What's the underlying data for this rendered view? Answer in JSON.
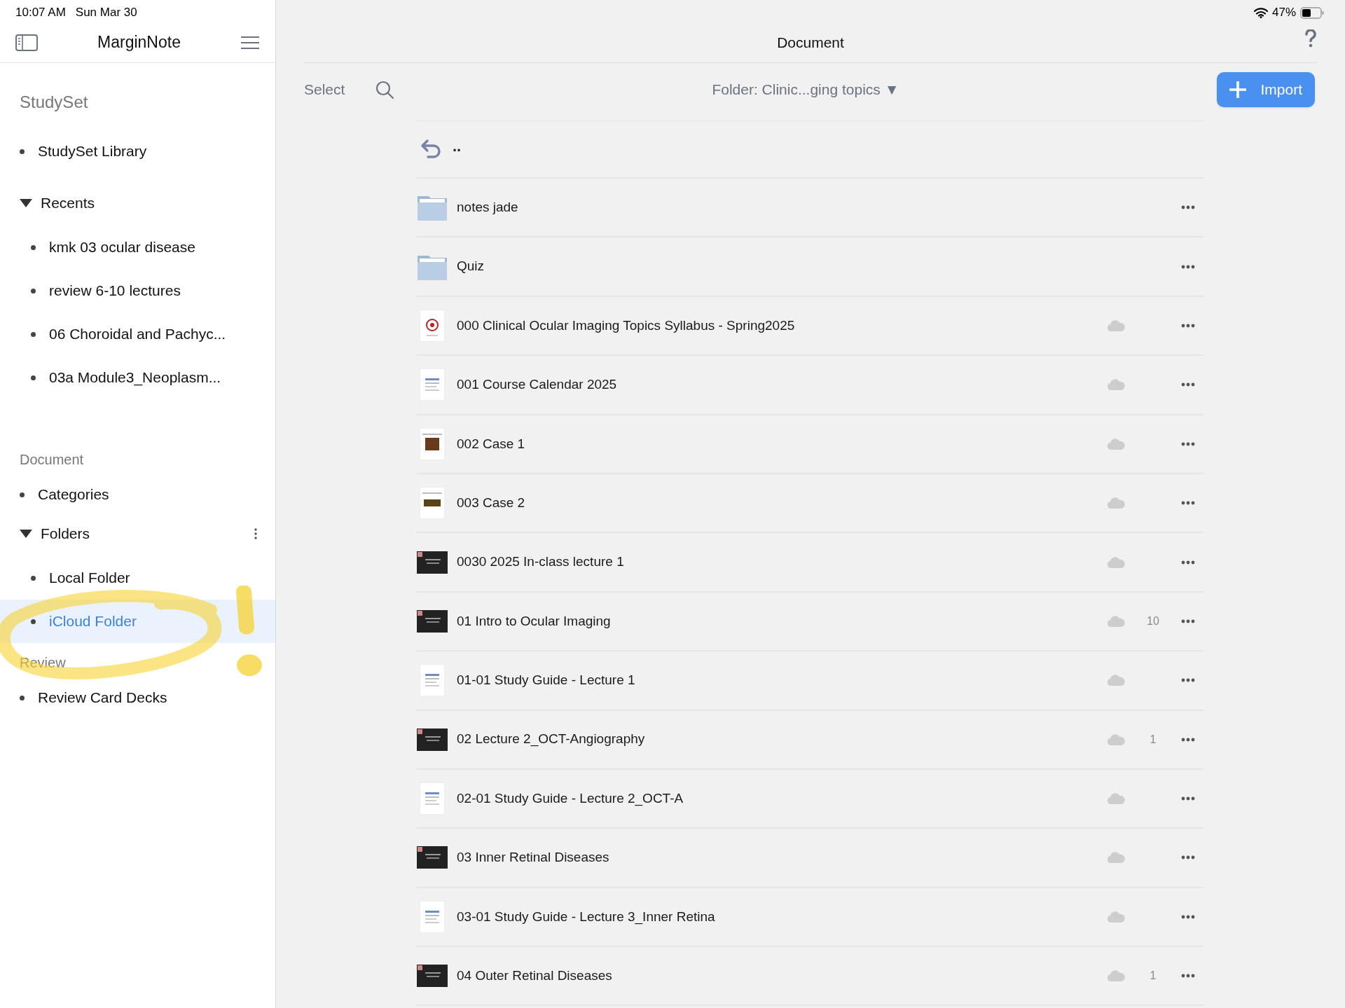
{
  "status_bar": {
    "time": "10:07 AM",
    "date": "Sun Mar 30",
    "battery": "47%"
  },
  "sidebar": {
    "title": "MarginNote",
    "sections": [
      {
        "title": "StudySet",
        "items": [
          {
            "label": "StudySet Library",
            "selected": false
          }
        ]
      },
      {
        "items": [
          {
            "label": "Recents",
            "selected": false,
            "expanded": true,
            "has_menu": false,
            "children": [
              {
                "label": "kmk 03 ocular disease",
                "selected": false
              },
              {
                "label": "review 6-10 lectures",
                "selected": false
              },
              {
                "label": "06 Choroidal and Pachyc...",
                "selected": false
              },
              {
                "label": "03a Module3_Neoplasm...",
                "selected": false
              }
            ]
          }
        ]
      },
      {
        "title": "Document",
        "items": [
          {
            "label": "Categories",
            "selected": false
          },
          {
            "label": "Folders",
            "selected": false,
            "expanded": true,
            "has_menu": true,
            "children": [
              {
                "label": "Local Folder",
                "selected": false
              },
              {
                "label": "iCloud Folder",
                "selected": true
              }
            ]
          }
        ]
      },
      {
        "title": "Review",
        "items": [
          {
            "label": "Review Card Decks",
            "selected": false
          }
        ]
      }
    ]
  },
  "main": {
    "title": "Document",
    "select": "Select",
    "folder": "Folder: Clinic...ging topics ▼",
    "import": "Import",
    "parent": "..",
    "files": [
      {
        "name": "notes jade",
        "kind": "folder"
      },
      {
        "name": "Quiz",
        "kind": "folder"
      },
      {
        "name": "000 Clinical Ocular Imaging Topics Syllabus - Spring2025",
        "kind": "seal"
      },
      {
        "name": "001 Course Calendar 2025",
        "kind": "page"
      },
      {
        "name": "002 Case 1",
        "kind": "photo"
      },
      {
        "name": "003 Case 2",
        "kind": "photo2"
      },
      {
        "name": "0030 2025 In-class lecture 1",
        "kind": "slide"
      },
      {
        "name": "01 Intro to Ocular Imaging",
        "kind": "slide",
        "count": "10"
      },
      {
        "name": "01-01 Study Guide - Lecture 1",
        "kind": "page"
      },
      {
        "name": "02 Lecture 2_OCT-Angiography",
        "kind": "slide",
        "count": "1"
      },
      {
        "name": "02-01 Study Guide - Lecture 2_OCT-A",
        "kind": "page"
      },
      {
        "name": "03 Inner Retinal Diseases",
        "kind": "slide"
      },
      {
        "name": "03-01 Study Guide - Lecture 3_Inner Retina",
        "kind": "page"
      },
      {
        "name": "04 Outer Retinal Diseases",
        "kind": "slide",
        "count": "1"
      }
    ]
  }
}
